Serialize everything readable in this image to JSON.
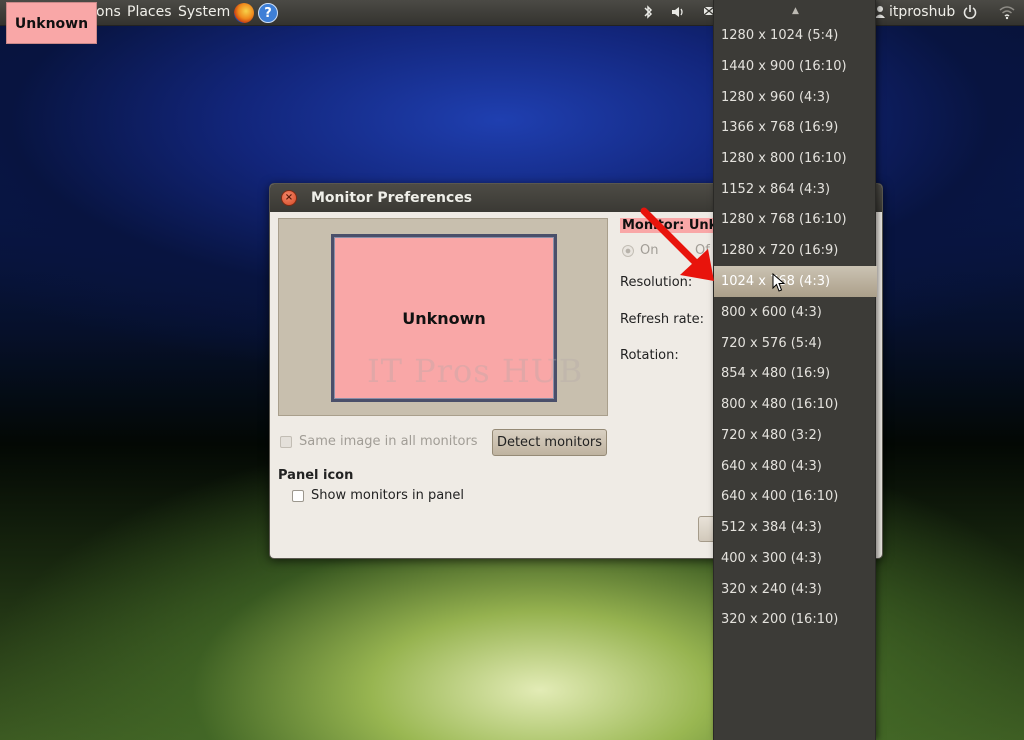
{
  "top_panel": {
    "menus": [
      "ons",
      "Places",
      "System"
    ],
    "user": "itproshub"
  },
  "unknown_tag": "Unknown",
  "dialog": {
    "title": "Monitor Preferences",
    "monitor_preview_label": "Unknown",
    "watermark": "IT Pros HUB",
    "same_image_label": "Same image in all monitors",
    "detect_button": "Detect monitors",
    "panel_icon_heading": "Panel icon",
    "show_monitors_label": "Show monitors in panel",
    "monitor_label": "Monitor: Unk",
    "radio_on": "On",
    "radio_off": "Of",
    "resolution_label": "Resolution:",
    "refresh_rate_label": "Refresh rate:",
    "rotation_label": "Rotation:"
  },
  "resolution_menu": {
    "selected": "1024 x 768 (4:3)",
    "options": [
      "1280 x 1024 (5:4)",
      "1440 x 900 (16:10)",
      "1280 x 960 (4:3)",
      "1366 x 768 (16:9)",
      "1280 x 800 (16:10)",
      "1152 x 864 (4:3)",
      "1280 x 768 (16:10)",
      "1280 x 720 (16:9)",
      "1024 x 768 (4:3)",
      "800 x 600 (4:3)",
      "720 x 576 (5:4)",
      "854 x 480 (16:9)",
      "800 x 480 (16:10)",
      "720 x 480 (3:2)",
      "640 x 480 (4:3)",
      "640 x 400 (16:10)",
      "512 x 384 (4:3)",
      "400 x 300 (4:3)",
      "320 x 240 (4:3)",
      "320 x 200 (16:10)"
    ]
  },
  "colors": {
    "highlight": "#f9a7a7",
    "arrow": "#e8140c",
    "menu_bg": "#3c3b37"
  }
}
